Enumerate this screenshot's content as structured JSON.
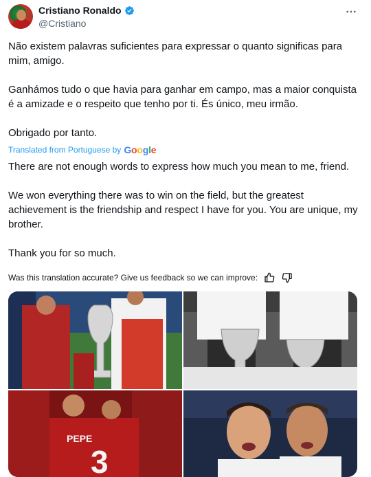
{
  "author": {
    "display_name": "Cristiano Ronaldo",
    "handle": "@Cristiano",
    "verified": true,
    "verified_color": "#1d9bf0"
  },
  "original_text": {
    "p1": "Não existem palavras suficientes para expressar o quanto significas para mim, amigo.",
    "p2": "Ganhámos tudo o que havia para ganhar em campo, mas a maior conquista é a amizade e o respeito que tenho por ti. És único, meu irmão.",
    "p3": "Obrigado por tanto."
  },
  "translation": {
    "label": "Translated from Portuguese by",
    "provider": "Google"
  },
  "translated_text": {
    "p1": "There are not enough words to express how much you mean to me, friend.",
    "p2": "We won everything there was to win on the field, but the greatest achievement is the friendship and respect I have for you. You are unique, my brother.",
    "p3": "Thank you for so much."
  },
  "feedback": {
    "question": "Was this translation accurate? Give us feedback so we can improve:",
    "positive_icon": "thumbs-up-icon",
    "negative_icon": "thumbs-down-icon"
  },
  "media": [
    {
      "name": "photo-euro-trophy",
      "description_icon": "photo"
    },
    {
      "name": "photo-champions-league-trophies",
      "description_icon": "photo"
    },
    {
      "name": "photo-portugal-celebration",
      "description_icon": "photo"
    },
    {
      "name": "photo-real-madrid-players",
      "description_icon": "photo"
    }
  ],
  "icons": {
    "more": "more-options-icon",
    "verified": "verified-badge-icon"
  }
}
